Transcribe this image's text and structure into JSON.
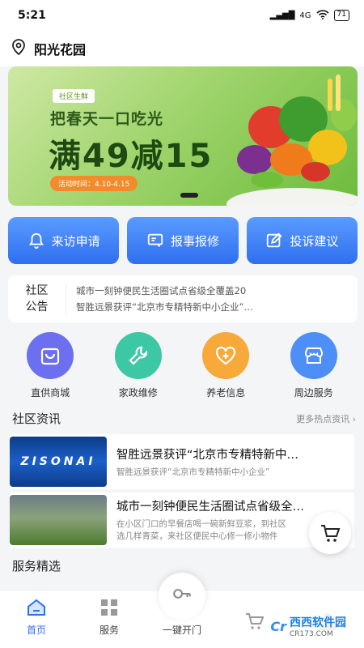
{
  "status": {
    "time": "5:21",
    "signal": "4G",
    "battery": "71"
  },
  "header": {
    "title": "阳光花园"
  },
  "banner": {
    "tag": "社区生鲜",
    "subtitle": "把春天一口吃光",
    "headline": "满49减15",
    "date": "活动时间：4.10-4.15"
  },
  "actions": [
    {
      "label": "来访申请",
      "icon": "bell-icon"
    },
    {
      "label": "报事报修",
      "icon": "report-icon"
    },
    {
      "label": "投诉建议",
      "icon": "edit-icon"
    }
  ],
  "notice": {
    "label_line1": "社区",
    "label_line2": "公告",
    "items": [
      "城市一刻钟便民生活圈试点省级全覆盖20",
      "智胜远景获评“北京市专精特新中小企业”…"
    ]
  },
  "services": [
    {
      "label": "直供商城",
      "icon": "bag-icon",
      "color": "#6c6ff0"
    },
    {
      "label": "家政维修",
      "icon": "wrench-icon",
      "color": "#3cc8a4"
    },
    {
      "label": "养老信息",
      "icon": "heart-icon",
      "color": "#f7a93a"
    },
    {
      "label": "周边服务",
      "icon": "store-icon",
      "color": "#4d8ff7"
    }
  ],
  "news": {
    "title": "社区资讯",
    "more": "更多热点资讯",
    "items": [
      {
        "headline": "智胜远景获评“北京市专精特新中…",
        "summary": "智胜远景获评“北京市专精特新中小企业”",
        "thumb_text": "ZISONAI"
      },
      {
        "headline": "城市一刻钟便民生活圈试点省级全…",
        "summary_line1": "在小区门口的早餐店喝一碗新鲜豆浆，到社区",
        "summary_line2": "选几样青菜，来社区便民中心修一修小物件"
      }
    ]
  },
  "featured": {
    "title": "服务精选"
  },
  "tabbar": [
    {
      "label": "首页",
      "icon": "home-icon",
      "active": true
    },
    {
      "label": "服务",
      "icon": "grid-icon",
      "active": false
    },
    {
      "label": "一键开门",
      "icon": "key-icon",
      "active": false
    },
    {
      "label": "",
      "icon": "cart-icon",
      "active": false
    },
    {
      "label": "",
      "icon": "user-icon",
      "active": false
    }
  ],
  "watermark": {
    "logo": "Cr",
    "name": "西西软件园",
    "url": "CR173.COM"
  },
  "colors": {
    "primary": "#2f6ff0",
    "banner_green": "#6cbb3b"
  }
}
